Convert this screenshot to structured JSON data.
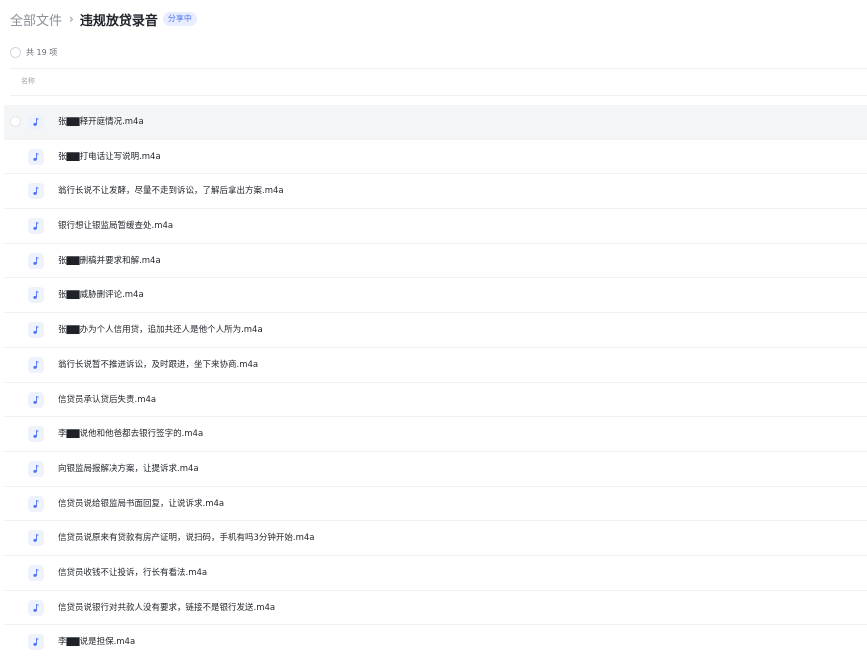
{
  "breadcrumb": {
    "root": "全部文件",
    "separator": "›",
    "current": "违规放贷录音",
    "badge": "分享中"
  },
  "summary": {
    "count_text": "共 19 项"
  },
  "table": {
    "column_name": "名称"
  },
  "files": [
    {
      "name": "张▇▇释开庭情况.m4a",
      "selected": true
    },
    {
      "name": "张▇▇打电话让写说明.m4a"
    },
    {
      "name": "翁行长说不让发酵，尽量不走到诉讼，了解后拿出方案.m4a"
    },
    {
      "name": "银行想让银监局暂缓查处.m4a"
    },
    {
      "name": "张▇▇删稿并要求和解.m4a"
    },
    {
      "name": "张▇▇威胁删评论.m4a"
    },
    {
      "name": "张▇▇办为个人信用贷，追加共还人是他个人所为.m4a"
    },
    {
      "name": "翁行长说暂不推进诉讼，及时跟进，坐下来协商.m4a"
    },
    {
      "name": "信贷员承认贷后失责.m4a"
    },
    {
      "name": "李▇▇说他和他爸都去银行签字的.m4a"
    },
    {
      "name": "向银监局报解决方案，让提诉求.m4a"
    },
    {
      "name": "信贷员说给银监局书面回复，让说诉求.m4a"
    },
    {
      "name": "信贷员说原来有贷款有房产证明，说扫码，手机有吗3分钟开始.m4a"
    },
    {
      "name": "信贷员收钱不让投诉，行长有看法.m4a"
    },
    {
      "name": "信贷员说银行对共款人没有要求，链接不是银行发送.m4a"
    },
    {
      "name": "李▇▇说是担保.m4a"
    }
  ],
  "colors": {
    "accent": "#4e72f5",
    "icon_bg": "#eef2fd",
    "selected_row": "#f4f5f6"
  },
  "icons": {
    "file": "music-note-icon"
  }
}
